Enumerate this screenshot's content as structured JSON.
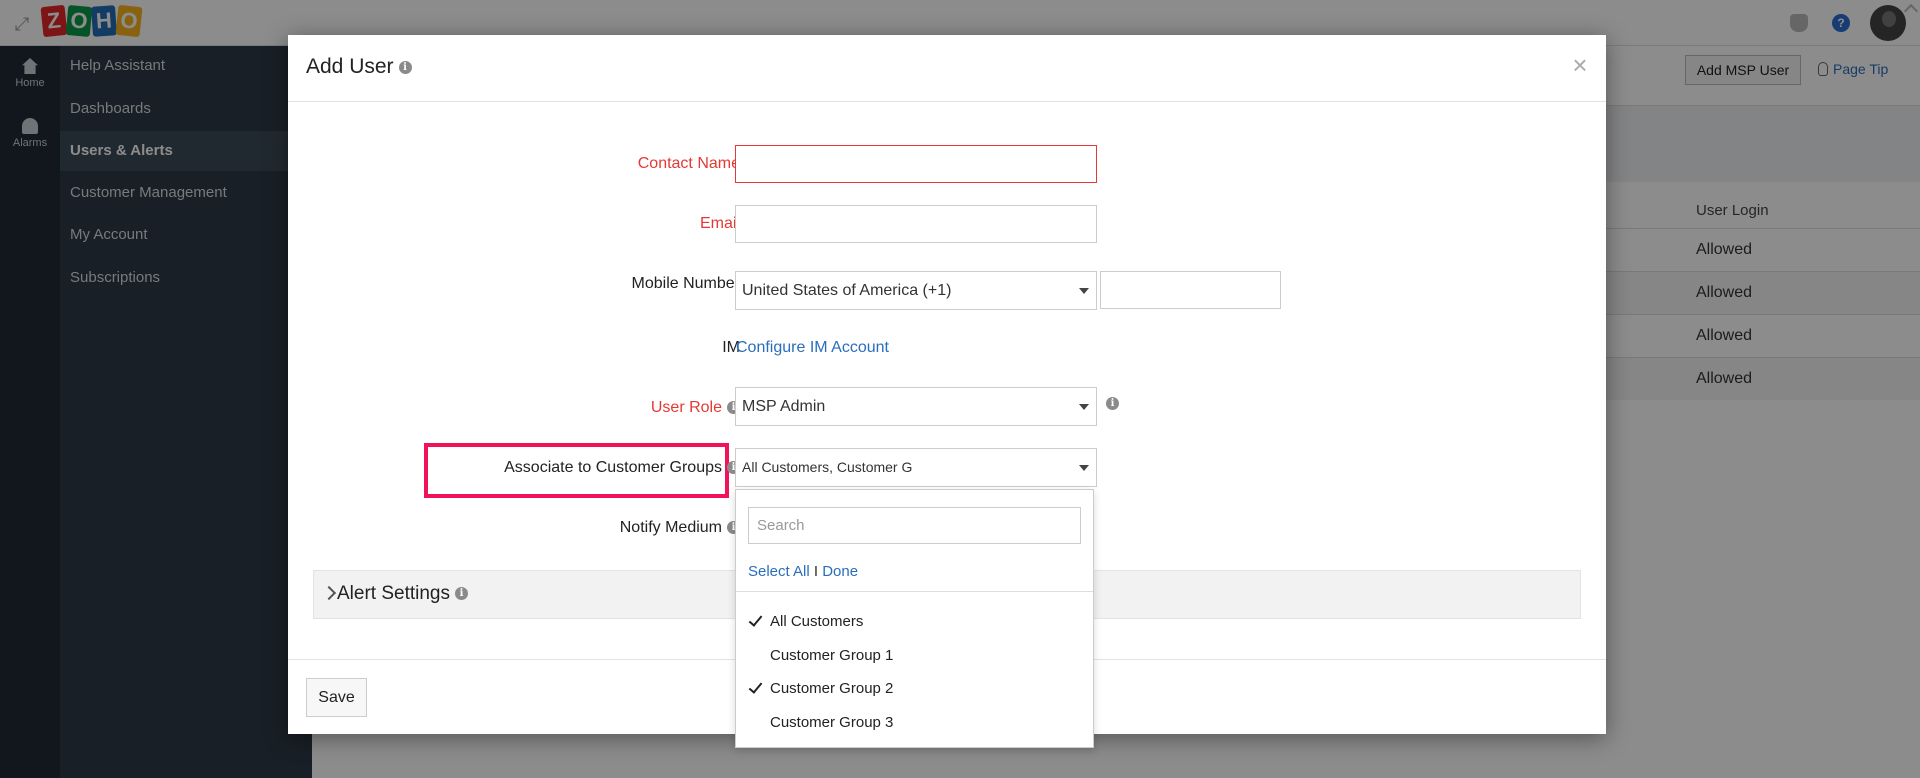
{
  "app": {
    "logo_letters": [
      "Z",
      "O",
      "H",
      "O"
    ]
  },
  "rail": {
    "home_label": "Home",
    "alarms_label": "Alarms"
  },
  "sidebar": {
    "items": [
      {
        "label": "Help Assistant"
      },
      {
        "label": "Dashboards"
      },
      {
        "label": "Users & Alerts"
      },
      {
        "label": "Customer Management"
      },
      {
        "label": "My Account"
      },
      {
        "label": "Subscriptions"
      }
    ],
    "active_index": 2
  },
  "content": {
    "add_msp_user_label": "Add MSP User",
    "page_tips_label": "Page Tip",
    "column_header": "User Login",
    "rows": [
      "Allowed",
      "Allowed",
      "Allowed",
      "Allowed"
    ]
  },
  "modal": {
    "title": "Add User",
    "close_symbol": "×",
    "fields": {
      "contact_name_label": "Contact Name",
      "email_label": "Email",
      "mobile_label": "Mobile Number",
      "country_value": "United States of America (+1)",
      "im_label": "IM",
      "configure_im_link": "Configure IM Account",
      "user_role_label": "User Role",
      "user_role_value": "MSP Admin",
      "customer_groups_label": "Associate to Customer Groups",
      "customer_groups_value": "All Customers, Customer G",
      "notify_medium_label": "Notify Medium"
    },
    "alert_settings_label": "Alert Settings",
    "save_label": "Save"
  },
  "dropdown": {
    "search_placeholder": "Search",
    "select_all_label": "Select All",
    "separator": "I",
    "done_label": "Done",
    "options": [
      {
        "label": "All Customers",
        "selected": true
      },
      {
        "label": "Customer Group 1",
        "selected": false
      },
      {
        "label": "Customer Group 2",
        "selected": true
      },
      {
        "label": "Customer Group 3",
        "selected": false
      }
    ]
  },
  "colors": {
    "required_label": "#e53935",
    "link": "#2a6ebb",
    "highlight_box": "#f0135a",
    "sidebar_bg": "#2c3945"
  }
}
